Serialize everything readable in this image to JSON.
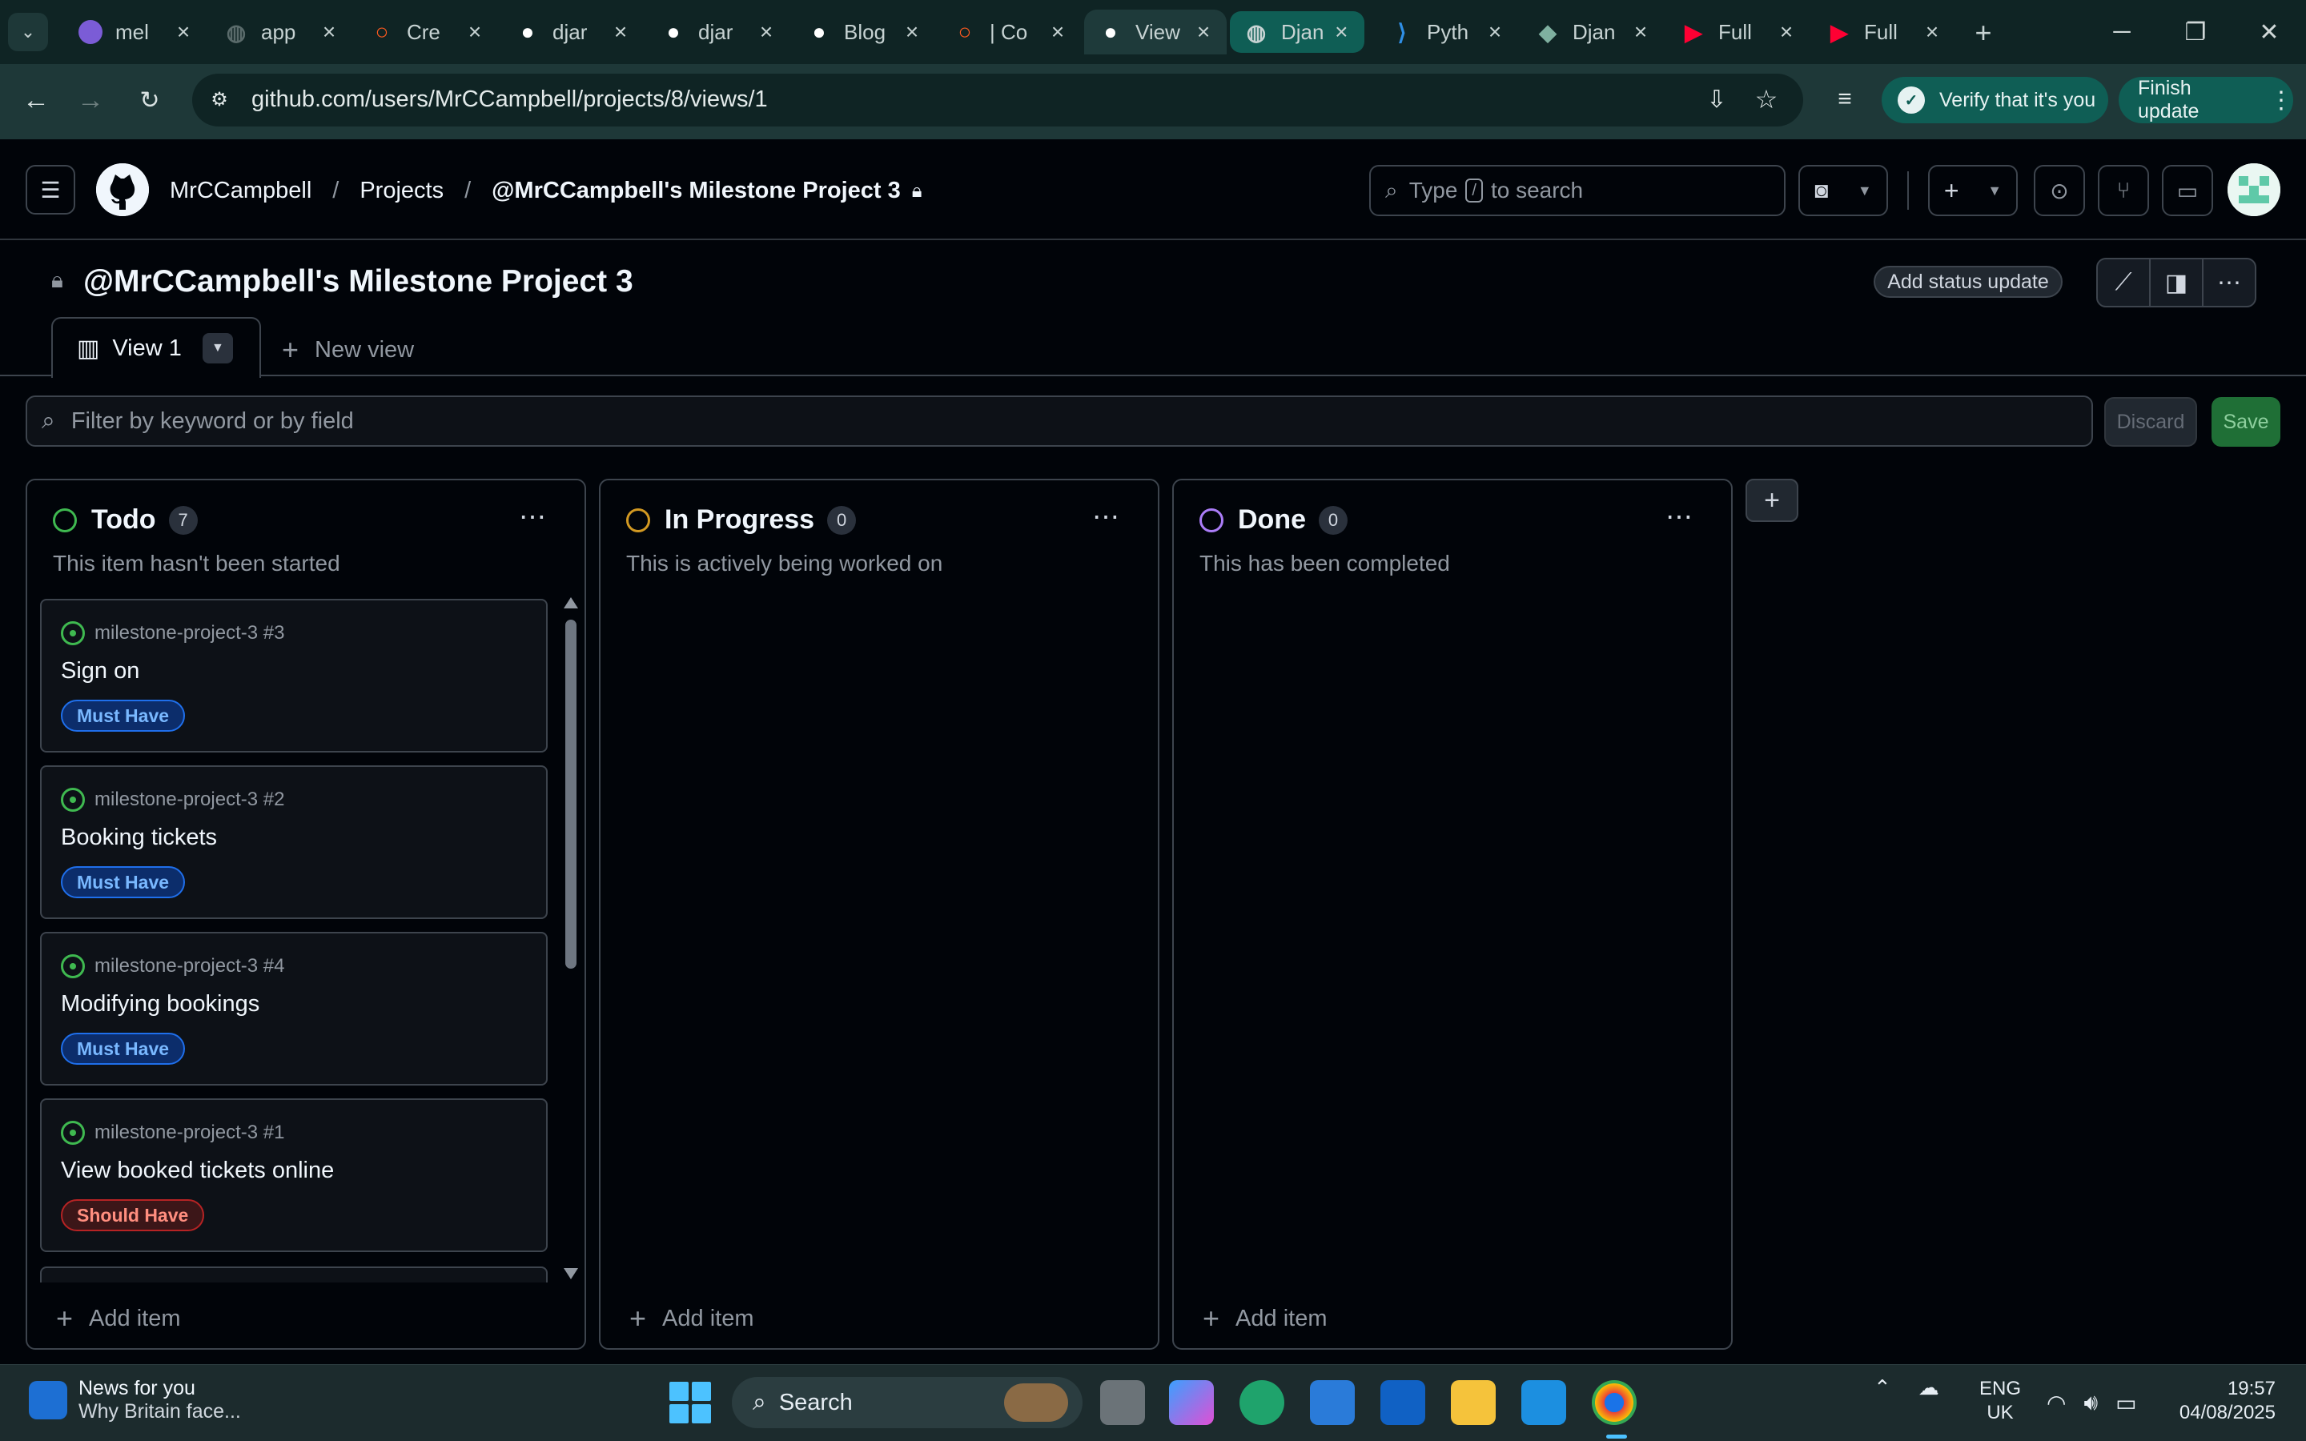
{
  "browser": {
    "tabs": [
      {
        "title": "mel",
        "favicon": "Hd",
        "color": "#7b5cd6"
      },
      {
        "title": "app",
        "favicon": "globe-icon",
        "color": "#5a6b6b"
      },
      {
        "title": "Cre",
        "favicon": "circle-o",
        "color": "#ff5a1f"
      },
      {
        "title": "djar",
        "favicon": "github-icon",
        "color": "#ffffff"
      },
      {
        "title": "djar",
        "favicon": "github-icon",
        "color": "#ffffff"
      },
      {
        "title": "Blog",
        "favicon": "github-icon",
        "color": "#ffffff"
      },
      {
        "title": "| Co",
        "favicon": "circle-o",
        "color": "#ff5a1f"
      },
      {
        "title": "View",
        "favicon": "github-icon",
        "color": "#ffffff"
      },
      {
        "title": "Djan",
        "favicon": "globe-icon",
        "color": "#c7d3d3"
      },
      {
        "title": "Pyth",
        "favicon": "vscode-icon",
        "color": "#2f8fe6"
      },
      {
        "title": "Djan",
        "favicon": "map-icon",
        "color": "#7fb0a0"
      },
      {
        "title": "Full",
        "favicon": "youtube-icon",
        "color": "#ff0033"
      },
      {
        "title": "Full",
        "favicon": "youtube-icon",
        "color": "#ff0033"
      }
    ],
    "url": "github.com/users/MrCCampbell/projects/8/views/1",
    "verify_label": "Verify that it's you",
    "finish_update_label": "Finish update"
  },
  "github": {
    "breadcrumbs": [
      "MrCCampbell",
      "Projects",
      "@MrCCampbell's Milestone Project 3"
    ],
    "search_placeholder_pre": "Type",
    "search_key": "/",
    "search_placeholder_post": "to search"
  },
  "project": {
    "title": "@MrCCampbell's Milestone Project 3",
    "status_update_label": "Add status update",
    "view_tab_label": "View 1",
    "new_view_label": "New view",
    "filter_placeholder": "Filter by keyword or by field",
    "discard_label": "Discard",
    "save_label": "Save"
  },
  "columns": [
    {
      "name": "Todo",
      "count": "7",
      "description": "This item hasn't been started",
      "dot_color": "#3fb950",
      "add_label": "Add item"
    },
    {
      "name": "In Progress",
      "count": "0",
      "description": "This is actively being worked on",
      "dot_color": "#d29922",
      "add_label": "Add item"
    },
    {
      "name": "Done",
      "count": "0",
      "description": "This has been completed",
      "dot_color": "#ab7df8",
      "add_label": "Add item"
    }
  ],
  "cards": [
    {
      "repo": "milestone-project-3 #3",
      "title": "Sign on",
      "label": "Must Have",
      "label_type": "must"
    },
    {
      "repo": "milestone-project-3 #2",
      "title": "Booking tickets",
      "label": "Must Have",
      "label_type": "must"
    },
    {
      "repo": "milestone-project-3 #4",
      "title": "Modifying bookings",
      "label": "Must Have",
      "label_type": "must"
    },
    {
      "repo": "milestone-project-3 #1",
      "title": "View booked tickets online",
      "label": "Should Have",
      "label_type": "should"
    }
  ],
  "taskbar": {
    "news_title": "News for you",
    "news_subtitle": "Why Britain face...",
    "search_label": "Search",
    "lang_line1": "ENG",
    "lang_line2": "UK",
    "time": "19:57",
    "date": "04/08/2025"
  }
}
